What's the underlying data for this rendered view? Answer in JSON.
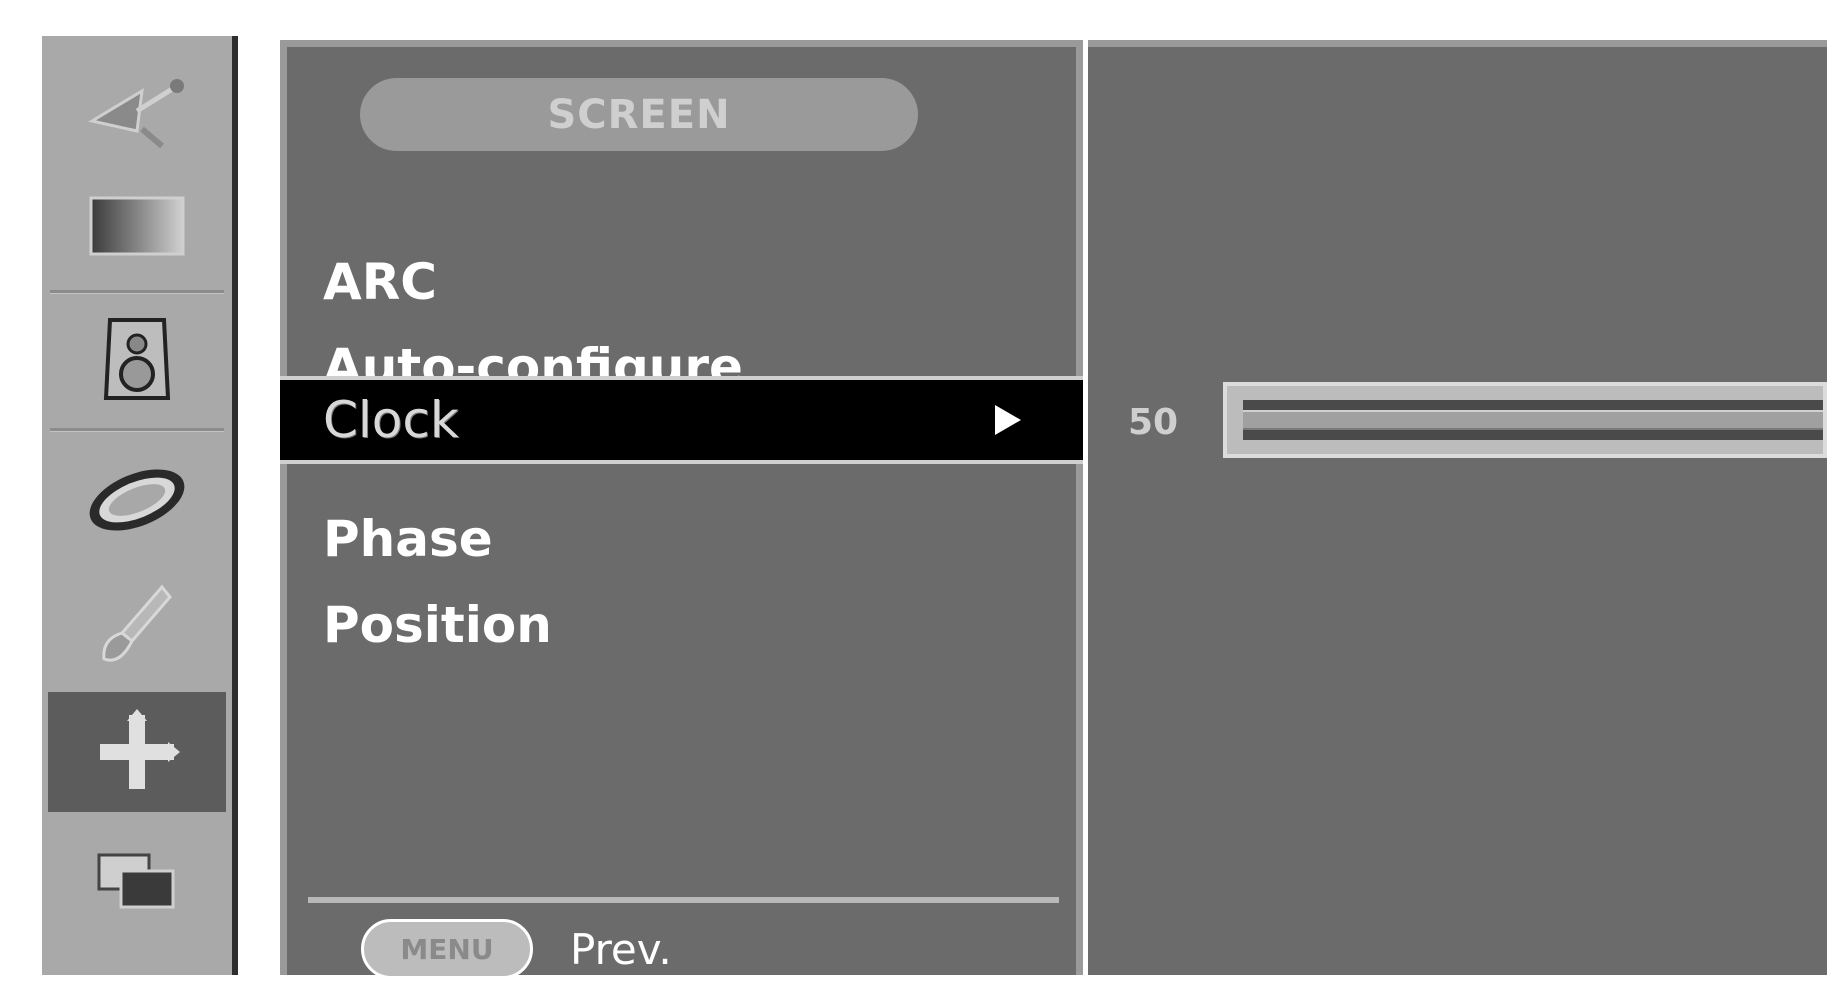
{
  "rail": {
    "icons": [
      {
        "name": "satellite-dish-icon",
        "active": false
      },
      {
        "name": "picture-icon",
        "active": false
      },
      {
        "name": "sound-speaker-icon",
        "active": false
      },
      {
        "name": "time-clock-icon",
        "active": false
      },
      {
        "name": "option-wrench-icon",
        "active": false
      },
      {
        "name": "screen-move-icon",
        "active": true
      },
      {
        "name": "pip-icon",
        "active": false
      }
    ]
  },
  "menu": {
    "title": "SCREEN",
    "items": [
      {
        "label": "ARC"
      },
      {
        "label": "Auto-configure"
      },
      {
        "label": "Clock",
        "selected": true
      },
      {
        "label": "Phase"
      },
      {
        "label": "Position"
      }
    ],
    "footer": {
      "key_label": "MENU",
      "action_label": "Prev."
    }
  },
  "adjust": {
    "value": "50",
    "level_fraction": 1.0
  },
  "colors": {
    "panel": "#6b6b6b",
    "rail": "#a9a9a9",
    "selected_row": "#000000",
    "text": "#ffffff"
  }
}
